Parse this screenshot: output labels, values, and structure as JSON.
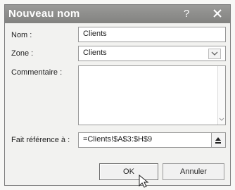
{
  "dialog": {
    "title": "Nouveau nom",
    "help_label": "?"
  },
  "form": {
    "name_label": "Nom :",
    "name_value": "Clients",
    "scope_label": "Zone :",
    "scope_value": "Clients",
    "comment_label": "Commentaire :",
    "comment_value": "",
    "refers_to_label": "Fait référence à :",
    "refers_to_value": "=Clients!$A$3:$H$9"
  },
  "buttons": {
    "ok_label": "OK",
    "cancel_label": "Annuler"
  },
  "icons": {
    "close": "close-icon",
    "dropdown": "chevron-down-icon",
    "collapse": "collapse-dialog-icon",
    "cursor": "mouse-pointer-icon"
  }
}
